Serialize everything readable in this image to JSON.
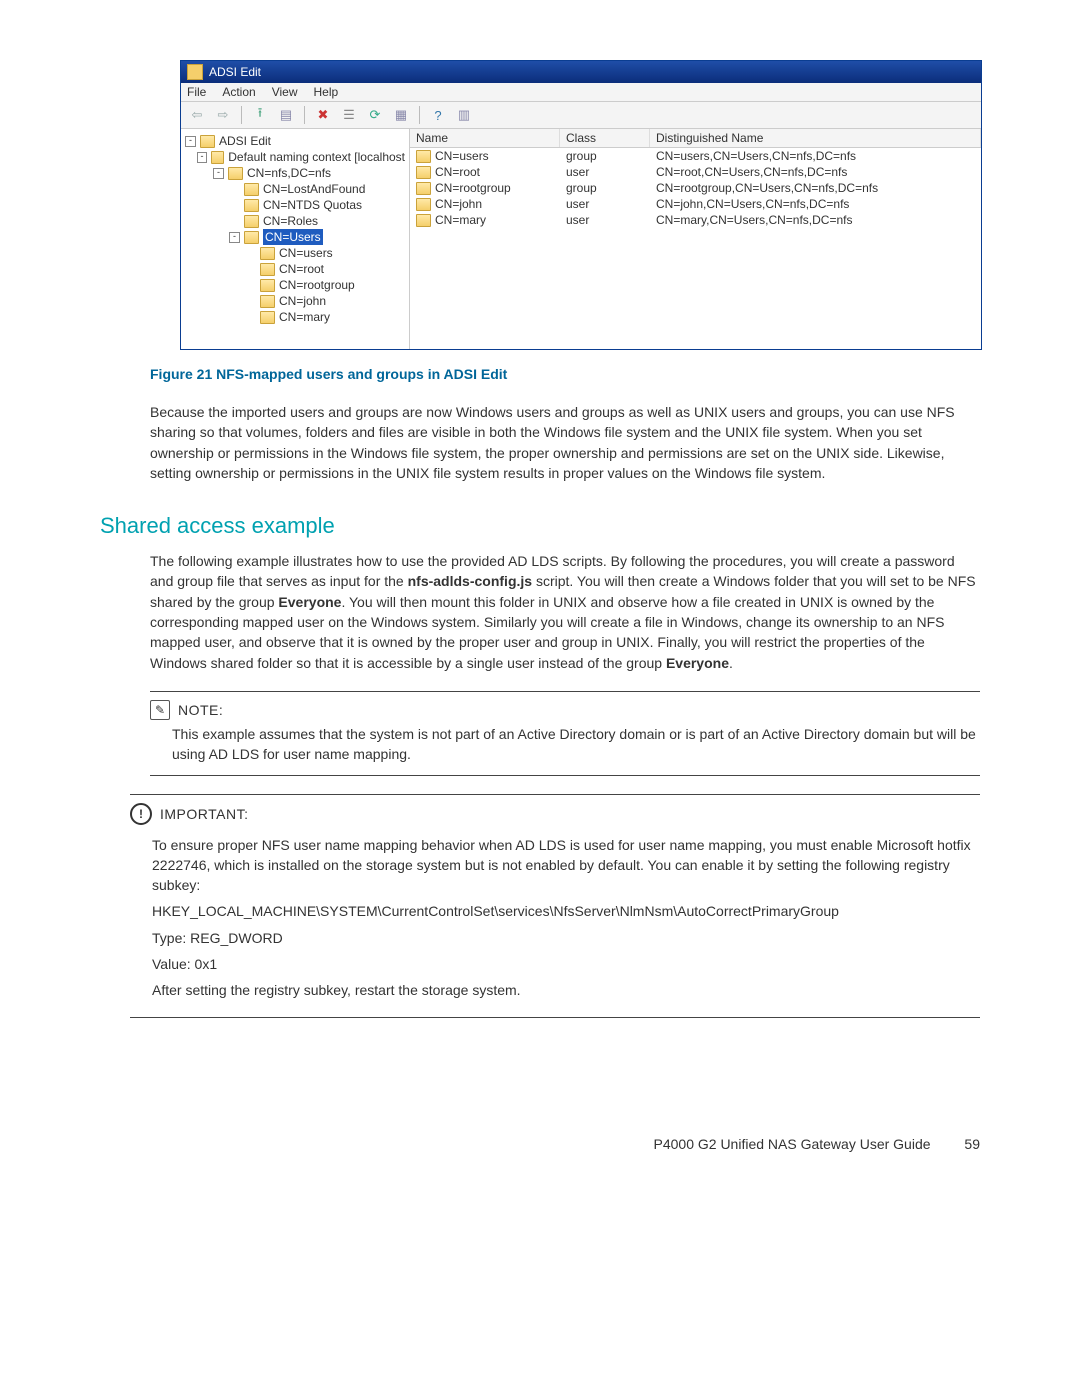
{
  "adsi_window": {
    "title": "ADSI Edit",
    "menu": [
      "File",
      "Action",
      "View",
      "Help"
    ],
    "toolbar_icons": [
      {
        "name": "back-arrow-icon",
        "glyph": "⇦",
        "color": "#9aa"
      },
      {
        "name": "forward-arrow-icon",
        "glyph": "⇨",
        "color": "#9aa"
      },
      {
        "name": "separator"
      },
      {
        "name": "up-folder-icon",
        "glyph": "⭱",
        "color": "#5a8"
      },
      {
        "name": "show-tree-icon",
        "glyph": "▤",
        "color": "#88a"
      },
      {
        "name": "separator"
      },
      {
        "name": "delete-icon",
        "glyph": "✖",
        "color": "#c33"
      },
      {
        "name": "list-icon",
        "glyph": "☰",
        "color": "#888"
      },
      {
        "name": "refresh-icon",
        "glyph": "⟳",
        "color": "#3a8"
      },
      {
        "name": "export-icon",
        "glyph": "▦",
        "color": "#88a"
      },
      {
        "name": "separator"
      },
      {
        "name": "help-icon",
        "glyph": "?",
        "color": "#37a"
      },
      {
        "name": "panel-icon",
        "glyph": "▥",
        "color": "#88a"
      }
    ],
    "tree": [
      {
        "indent": 0,
        "expander": "-",
        "icon": "app",
        "label": "ADSI Edit"
      },
      {
        "indent": 1,
        "expander": "-",
        "icon": "doc",
        "label": "Default naming context [localhost"
      },
      {
        "indent": 2,
        "expander": "-",
        "icon": "folder",
        "label": "CN=nfs,DC=nfs"
      },
      {
        "indent": 3,
        "expander": "",
        "icon": "folder",
        "label": "CN=LostAndFound"
      },
      {
        "indent": 3,
        "expander": "",
        "icon": "folder",
        "label": "CN=NTDS Quotas"
      },
      {
        "indent": 3,
        "expander": "",
        "icon": "folder",
        "label": "CN=Roles"
      },
      {
        "indent": 3,
        "expander": "-",
        "icon": "folder",
        "label": "CN=Users",
        "selected": true
      },
      {
        "indent": 4,
        "expander": "",
        "icon": "folder",
        "label": "CN=users"
      },
      {
        "indent": 4,
        "expander": "",
        "icon": "folder",
        "label": "CN=root"
      },
      {
        "indent": 4,
        "expander": "",
        "icon": "folder",
        "label": "CN=rootgroup"
      },
      {
        "indent": 4,
        "expander": "",
        "icon": "folder",
        "label": "CN=john"
      },
      {
        "indent": 4,
        "expander": "",
        "icon": "folder",
        "label": "CN=mary"
      }
    ],
    "columns": [
      "Name",
      "Class",
      "Distinguished Name"
    ],
    "rows": [
      {
        "name": "CN=users",
        "class": "group",
        "dn": "CN=users,CN=Users,CN=nfs,DC=nfs"
      },
      {
        "name": "CN=root",
        "class": "user",
        "dn": "CN=root,CN=Users,CN=nfs,DC=nfs"
      },
      {
        "name": "CN=rootgroup",
        "class": "group",
        "dn": "CN=rootgroup,CN=Users,CN=nfs,DC=nfs"
      },
      {
        "name": "CN=john",
        "class": "user",
        "dn": "CN=john,CN=Users,CN=nfs,DC=nfs"
      },
      {
        "name": "CN=mary",
        "class": "user",
        "dn": "CN=mary,CN=Users,CN=nfs,DC=nfs"
      }
    ]
  },
  "figure_caption": "Figure 21 NFS-mapped users and groups in ADSI Edit",
  "para_after_figure": "Because the imported users and groups are now Windows users and groups as well as UNIX users and groups, you can use NFS sharing so that volumes, folders and files are visible in both the Windows file system and the UNIX file system. When you set ownership or permissions in the Windows file system, the proper ownership and permissions are set on the UNIX side. Likewise, setting ownership or permissions in the UNIX file system results in proper values on the Windows file system.",
  "section_title": "Shared access example",
  "section_para_parts": {
    "p1": "The following example illustrates how to use the provided AD LDS scripts. By following the procedures, you will create a password and group file that serves as input for the ",
    "b1": "nfs-adlds-config.js",
    "p2": " script. You will then create a Windows folder that you will set to be NFS shared by the group ",
    "b2": "Everyone",
    "p3": ". You will then mount this folder in UNIX and observe how a file created in UNIX is owned by the corresponding mapped user on the Windows system. Similarly you will create a file in Windows, change its ownership to an NFS mapped user, and observe that it is owned by the proper user and group in UNIX. Finally, you will restrict the properties of the Windows shared folder so that it is accessible by a single user instead of the group ",
    "b3": "Everyone",
    "p4": "."
  },
  "note": {
    "label": "NOTE:",
    "body": "This example assumes that the system is not part of an Active Directory domain or is part of an Active Directory domain but will be using AD LDS for user name mapping."
  },
  "important": {
    "label": "IMPORTANT:",
    "p1": "To ensure proper NFS user name mapping behavior when AD LDS is used for user name mapping, you must enable Microsoft hotfix 2222746, which is installed on the storage system but is not enabled by default. You can enable it by setting the following registry subkey:",
    "reg": "HKEY_LOCAL_MACHINE\\SYSTEM\\CurrentControlSet\\services\\NfsServer\\NlmNsm\\AutoCorrectPrimaryGroup",
    "type_line": "Type: REG_DWORD",
    "value_line": "Value: 0x1",
    "p2": "After setting the registry subkey, restart the storage system."
  },
  "footer": {
    "doc": "P4000 G2 Unified NAS Gateway User Guide",
    "page": "59"
  }
}
